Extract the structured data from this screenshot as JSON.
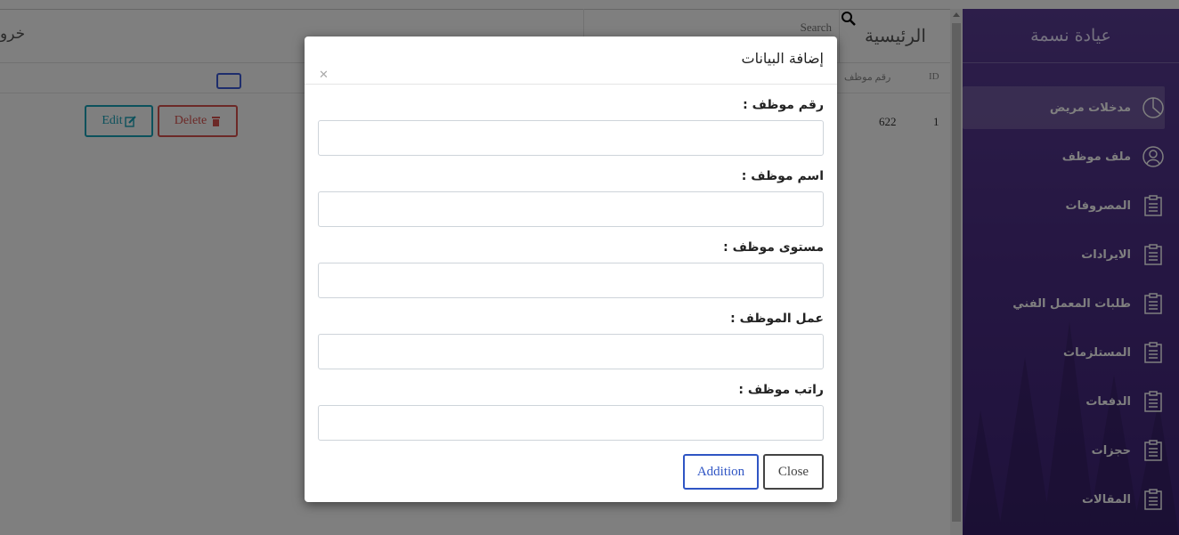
{
  "brand": "عيادة نسمة",
  "header": {
    "page_title": "الرئيسية",
    "search_placeholder": "Search",
    "logout": "خرو"
  },
  "sidebar": {
    "items": [
      {
        "label": "مدخلات مريض",
        "icon": "pie-chart-icon",
        "active": true
      },
      {
        "label": "ملف موظف",
        "icon": "user-icon",
        "active": false
      },
      {
        "label": "المصروفات",
        "icon": "clipboard-icon",
        "active": false
      },
      {
        "label": "الايرادات",
        "icon": "clipboard-icon",
        "active": false
      },
      {
        "label": "طلبات المعمل الفني",
        "icon": "clipboard-icon",
        "active": false
      },
      {
        "label": "المستلزمات",
        "icon": "clipboard-icon",
        "active": false
      },
      {
        "label": "الدفعات",
        "icon": "clipboard-icon",
        "active": false
      },
      {
        "label": "حجزات",
        "icon": "clipboard-icon",
        "active": false
      },
      {
        "label": "المقالات",
        "icon": "clipboard-icon",
        "active": false
      }
    ]
  },
  "table": {
    "headers": {
      "id": "ID",
      "employee_number": "رقم موظف"
    },
    "rows": [
      {
        "id": "1",
        "employee_number": "622",
        "delete": "Delete",
        "edit": "Edit"
      }
    ]
  },
  "modal": {
    "title": "إضافة البيانات",
    "fields": [
      {
        "label": "رقم موظف :",
        "value": ""
      },
      {
        "label": "اسم موظف :",
        "value": ""
      },
      {
        "label": "مستوى موظف :",
        "value": ""
      },
      {
        "label": "عمل الموظف :",
        "value": ""
      },
      {
        "label": "راتب موظف :",
        "value": ""
      }
    ],
    "buttons": {
      "addition": "Addition",
      "close": "Close"
    }
  },
  "colors": {
    "sidebar": "#4c2e86",
    "delete": "#d9534f",
    "edit": "#17a2b8",
    "primary": "#2f55c4"
  }
}
